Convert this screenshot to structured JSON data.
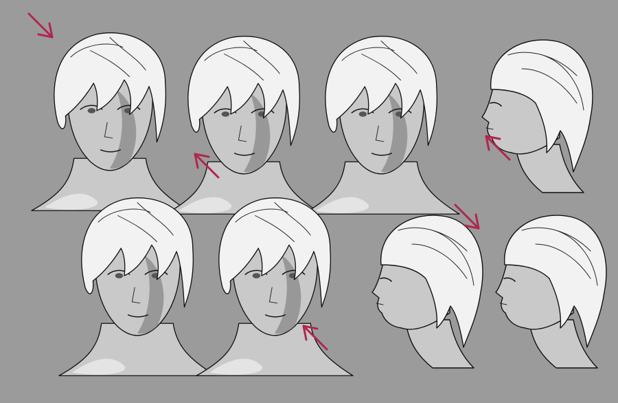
{
  "canvas": {
    "background": "#9b9b9b",
    "accent_arrow_color": "#b0264d"
  },
  "figures": [
    {
      "name": "head-sketch-1"
    },
    {
      "name": "head-sketch-2"
    },
    {
      "name": "head-sketch-3"
    },
    {
      "name": "head-sketch-4-profile"
    },
    {
      "name": "head-sketch-5"
    },
    {
      "name": "head-sketch-6"
    },
    {
      "name": "head-sketch-7-profile"
    },
    {
      "name": "head-sketch-8-profile"
    }
  ],
  "arrows": [
    {
      "name": "light-direction-arrow-1"
    },
    {
      "name": "light-direction-arrow-2"
    },
    {
      "name": "light-direction-arrow-3"
    },
    {
      "name": "light-direction-arrow-4"
    },
    {
      "name": "light-direction-arrow-5"
    }
  ]
}
